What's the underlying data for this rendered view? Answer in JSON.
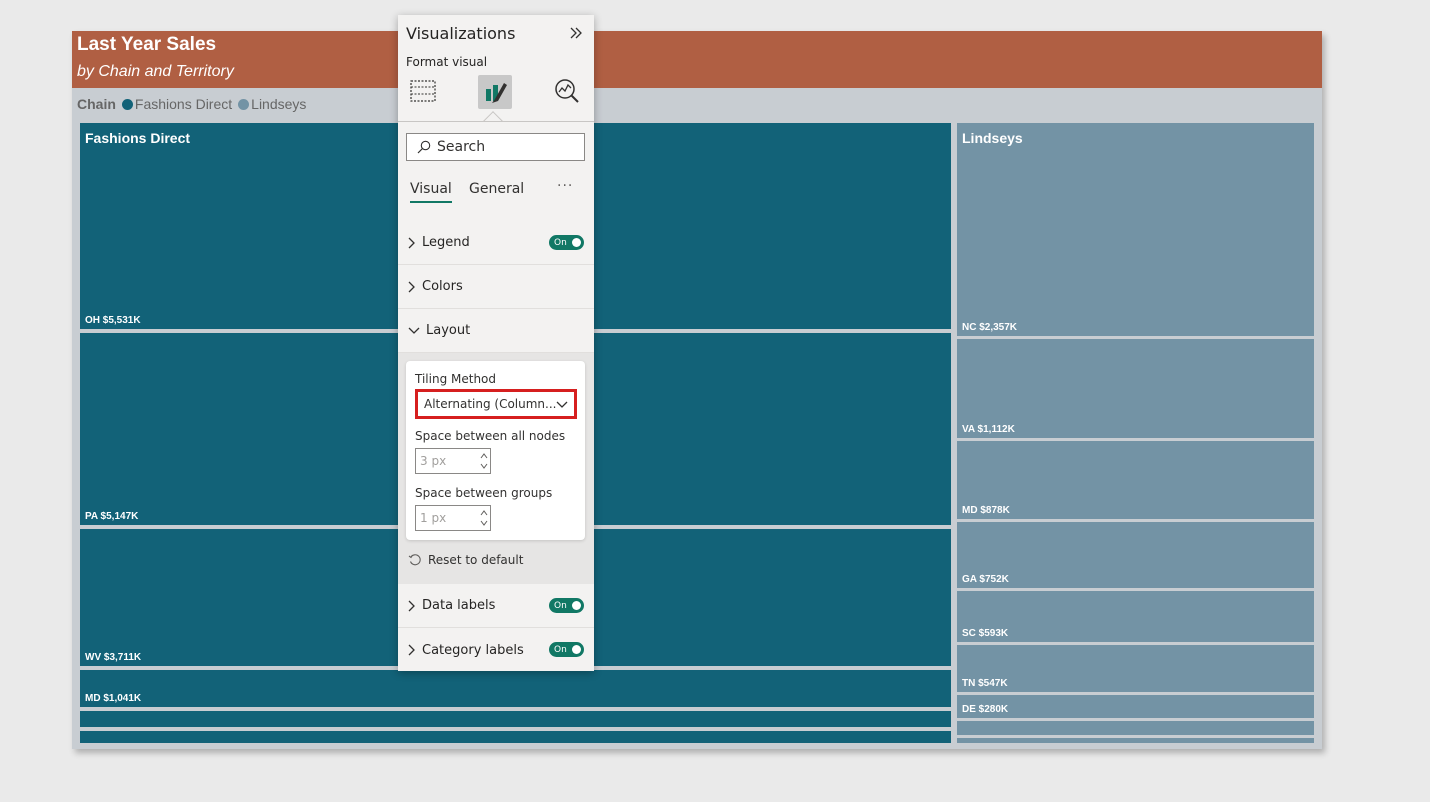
{
  "report": {
    "title": "Last Year Sales",
    "subtitle": "by Chain and Territory",
    "legend": {
      "title": "Chain",
      "items": [
        {
          "label": "Fashions Direct",
          "color": "#126278"
        },
        {
          "label": "Lindseys",
          "color": "#7393a5"
        }
      ]
    },
    "groups": {
      "fashions_direct": "Fashions Direct",
      "lindseys": "Lindseys"
    },
    "tiles": {
      "fd_oh": "OH $5,531K",
      "fd_pa": "PA $5,147K",
      "fd_wv": "WV $3,711K",
      "fd_md": "MD $1,041K",
      "li_nc": "NC $2,357K",
      "li_va": "VA $1,112K",
      "li_md": "MD $878K",
      "li_ga": "GA $752K",
      "li_sc": "SC $593K",
      "li_tn": "TN $547K",
      "li_de": "DE $280K"
    },
    "colors": {
      "title_bar": "#b05f43",
      "fashions_direct": "#126278",
      "lindseys": "#7393a5"
    }
  },
  "pane": {
    "title": "Visualizations",
    "subtitle": "Format visual",
    "icons": [
      "build-visual-icon",
      "format-visual-icon",
      "analytics-icon"
    ],
    "search_placeholder": "Search",
    "tabs": {
      "visual": "Visual",
      "general": "General",
      "more": "···"
    },
    "sections": {
      "legend": {
        "label": "Legend",
        "toggle": "On"
      },
      "colors": {
        "label": "Colors"
      },
      "layout": {
        "label": "Layout"
      },
      "data_labels": {
        "label": "Data labels",
        "toggle": "On"
      },
      "category_labels": {
        "label": "Category labels",
        "toggle": "On"
      }
    },
    "layout": {
      "tiling_label": "Tiling Method",
      "tiling_value": "Alternating (Column...",
      "space_nodes_label": "Space between all nodes",
      "space_nodes_value": "3 px",
      "space_groups_label": "Space between groups",
      "space_groups_value": "1 px",
      "reset_label": "Reset to default"
    },
    "accent_color": "#117865",
    "highlight_color": "#d61f1f"
  }
}
